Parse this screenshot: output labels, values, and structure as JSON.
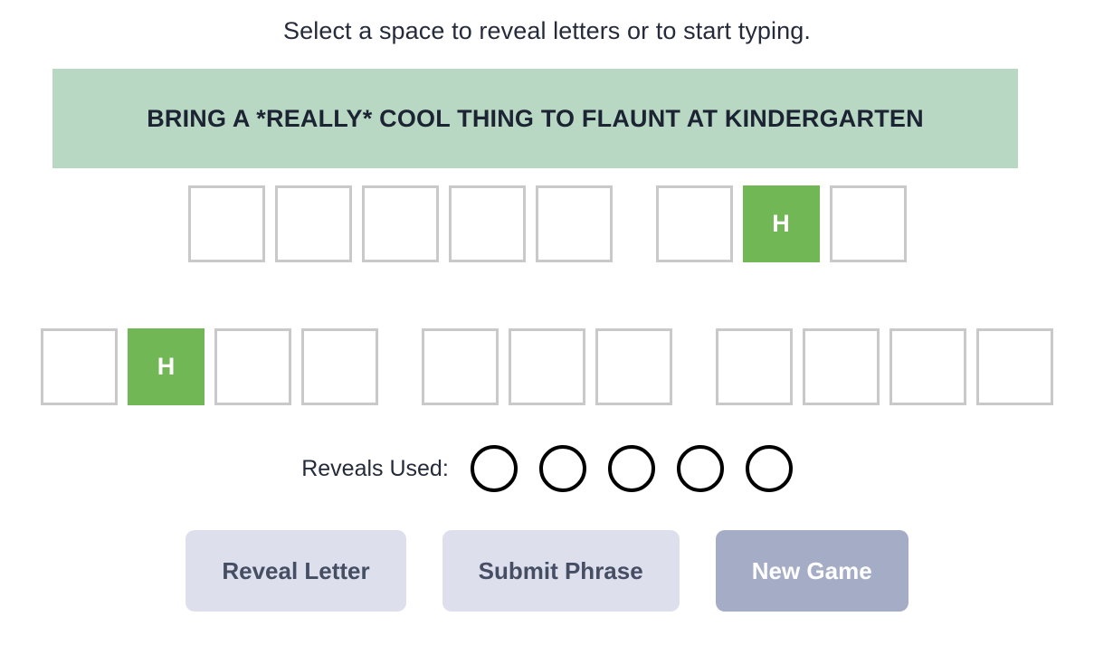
{
  "header": {
    "instruction": "Select a space to reveal letters or to start typing."
  },
  "phrase_banner": {
    "text": "BRING A *REALLY* COOL THING TO FLAUNT AT KINDERGARTEN",
    "background_color": "#b8d8c4",
    "text_color": "#1c2433"
  },
  "board": {
    "tile_colors": {
      "empty_border": "#c9c9c9",
      "empty_background": "#ffffff",
      "revealed_background": "#72b755",
      "revealed_text": "#ffffff"
    },
    "rows": [
      {
        "words": [
          {
            "tiles": [
              {
                "letter": "",
                "revealed": false
              },
              {
                "letter": "",
                "revealed": false
              },
              {
                "letter": "",
                "revealed": false
              },
              {
                "letter": "",
                "revealed": false
              },
              {
                "letter": "",
                "revealed": false
              }
            ]
          },
          {
            "tiles": [
              {
                "letter": "",
                "revealed": false
              },
              {
                "letter": "H",
                "revealed": true
              },
              {
                "letter": "",
                "revealed": false
              }
            ]
          }
        ]
      },
      {
        "words": [
          {
            "tiles": [
              {
                "letter": "",
                "revealed": false
              },
              {
                "letter": "H",
                "revealed": true
              },
              {
                "letter": "",
                "revealed": false
              },
              {
                "letter": "",
                "revealed": false
              }
            ]
          },
          {
            "tiles": [
              {
                "letter": "",
                "revealed": false
              },
              {
                "letter": "",
                "revealed": false
              },
              {
                "letter": "",
                "revealed": false
              }
            ]
          },
          {
            "tiles": [
              {
                "letter": "",
                "revealed": false
              },
              {
                "letter": "",
                "revealed": false
              },
              {
                "letter": "",
                "revealed": false
              },
              {
                "letter": "",
                "revealed": false
              }
            ]
          }
        ]
      }
    ]
  },
  "reveals": {
    "label": "Reveals Used:",
    "total": 5,
    "used": 0,
    "dots": [
      {
        "used": false
      },
      {
        "used": false
      },
      {
        "used": false
      },
      {
        "used": false
      },
      {
        "used": false
      }
    ]
  },
  "buttons": [
    {
      "label": "Reveal Letter",
      "name": "reveal-letter-button",
      "style": "secondary"
    },
    {
      "label": "Submit Phrase",
      "name": "submit-phrase-button",
      "style": "secondary"
    },
    {
      "label": "New Game",
      "name": "new-game-button",
      "style": "primary"
    }
  ]
}
